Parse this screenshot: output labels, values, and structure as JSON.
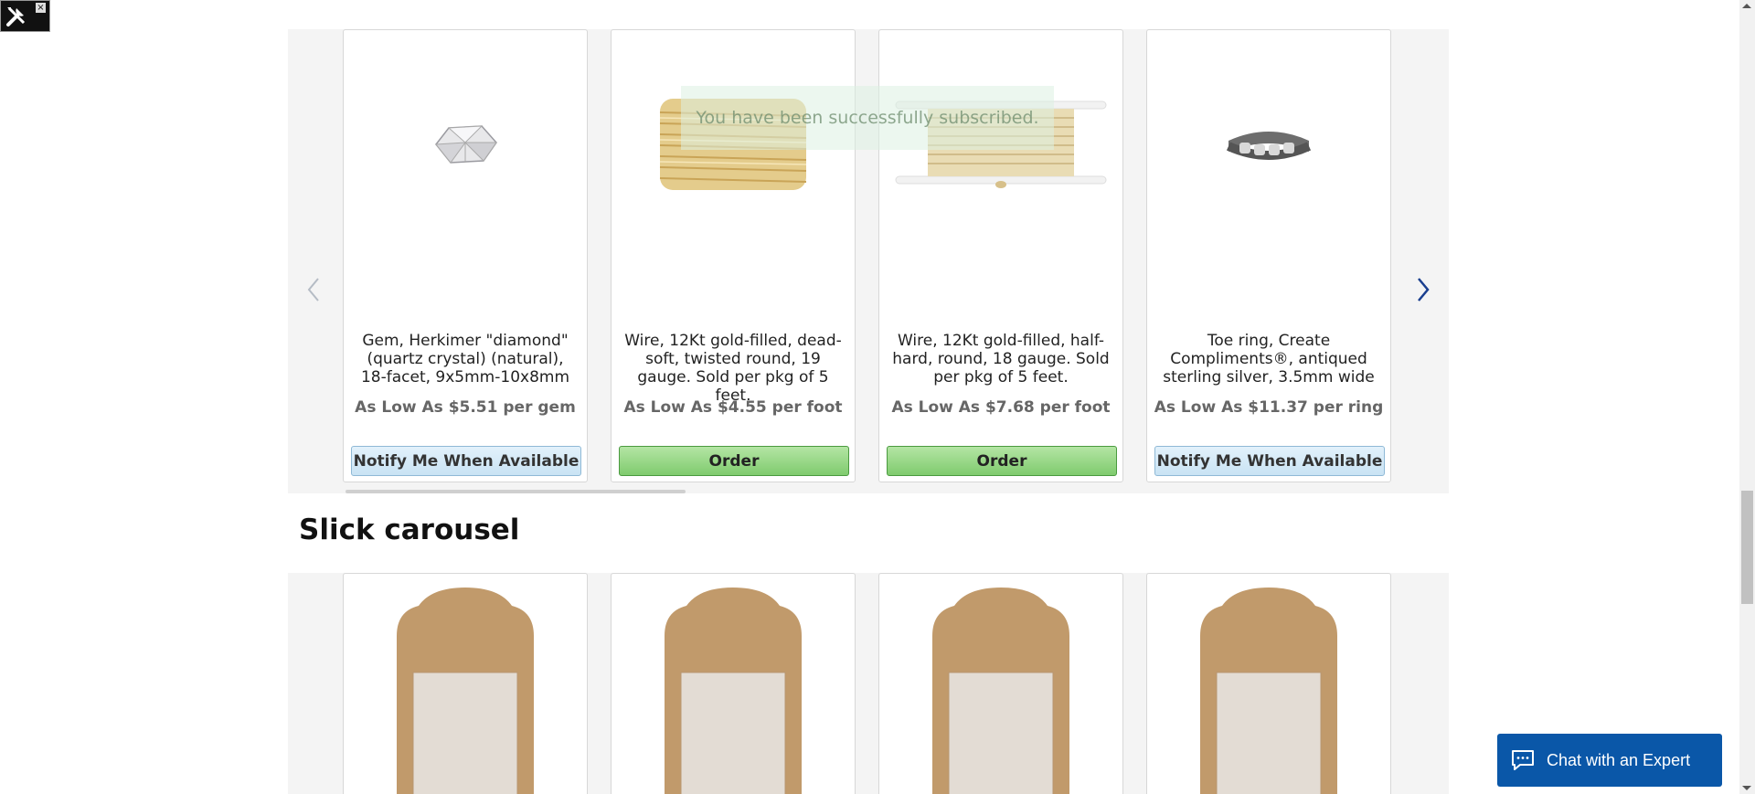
{
  "devtools": {
    "close_label": "×",
    "icon": "tools-icon"
  },
  "toast": {
    "message": "You have been successfully subscribed."
  },
  "carousel_one": {
    "prev_icon": "chevron-left-icon",
    "next_icon": "chevron-right-icon",
    "products": [
      {
        "image": "herkimer-diamond-gem",
        "title": "Gem, Herkimer \"diamond\" (quartz crystal) (natural), 18-facet, 9x5mm-10x8mm",
        "price": "As Low As $5.51 per gem",
        "button": "Notify Me When Available",
        "button_type": "notify"
      },
      {
        "image": "twisted-gold-wire",
        "title": "Wire, 12Kt gold-filled, dead-soft, twisted round, 19 gauge. Sold per pkg of 5 feet.",
        "price": "As Low As $4.55 per foot",
        "button": "Order",
        "button_type": "order"
      },
      {
        "image": "gold-wire-spool",
        "title": "Wire, 12Kt gold-filled, half-hard, round, 18 gauge. Sold per pkg of 5 feet.",
        "price": "As Low As $7.68 per foot",
        "button": "Order",
        "button_type": "order"
      },
      {
        "image": "silver-toe-ring",
        "title": "Toe ring, Create Compliments®, antiqued sterling silver, 3.5mm wide",
        "price": "As Low As $11.37 per ring",
        "button": "Notify Me When Available",
        "button_type": "notify"
      }
    ]
  },
  "slick_section": {
    "title": "Slick carousel",
    "cards": [
      {
        "image": "kraft-tag-card"
      },
      {
        "image": "kraft-tag-card"
      },
      {
        "image": "kraft-tag-card"
      },
      {
        "image": "kraft-tag-card"
      }
    ]
  },
  "chat": {
    "label": "Chat with an Expert",
    "icon": "chat-bubble-icon"
  },
  "colors": {
    "chat_bg": "#0a57a8",
    "order_green": "#7fcb6e",
    "notify_blue": "#c9e3f4",
    "nav_arrow_active": "#1a3f8f",
    "nav_arrow_inactive": "#b5bcc5"
  }
}
